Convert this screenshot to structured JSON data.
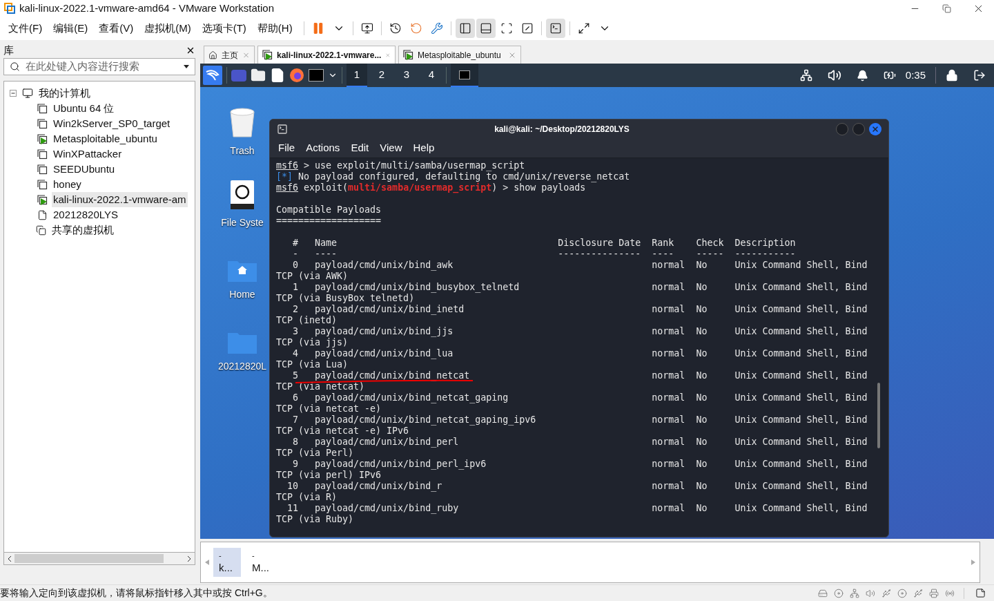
{
  "window": {
    "title": "kali-linux-2022.1-vmware-amd64 - VMware Workstation"
  },
  "menu": [
    "文件(F)",
    "编辑(E)",
    "查看(V)",
    "虚拟机(M)",
    "选项卡(T)",
    "帮助(H)"
  ],
  "library": {
    "title": "库",
    "search": {
      "placeholder": "在此处键入内容进行搜索"
    },
    "tree": [
      {
        "label": "我的计算机",
        "kind": "computer",
        "expanded": true,
        "children": [
          {
            "label": "Ubuntu 64 位",
            "kind": "vm",
            "running": false,
            "selected": false
          },
          {
            "label": "Win2kServer_SP0_target",
            "kind": "vm",
            "running": false,
            "selected": false
          },
          {
            "label": "Metasploitable_ubuntu",
            "kind": "vm",
            "running": true,
            "selected": false
          },
          {
            "label": "WinXPattacker",
            "kind": "vm",
            "running": false,
            "selected": false
          },
          {
            "label": "SEEDUbuntu",
            "kind": "vm",
            "running": false,
            "selected": false
          },
          {
            "label": "honey",
            "kind": "vm",
            "running": false,
            "selected": false
          },
          {
            "label": "kali-linux-2022.1-vmware-am",
            "kind": "vm",
            "running": true,
            "selected": true
          },
          {
            "label": "20212820LYS",
            "kind": "folder",
            "selected": false
          }
        ]
      },
      {
        "label": "共享的虚拟机",
        "kind": "shared"
      }
    ]
  },
  "tabs": [
    {
      "label": "主页",
      "kind": "home",
      "selected": false
    },
    {
      "label": "kali-linux-2022.1-vmware...",
      "kind": "vm",
      "selected": true
    },
    {
      "label": "Metasploitable_ubuntu",
      "kind": "vm",
      "selected": false
    }
  ],
  "guest": {
    "panel": {
      "workspaces": [
        {
          "label": "1",
          "selected": true
        },
        {
          "label": "2",
          "selected": false
        },
        {
          "label": "3",
          "selected": false
        },
        {
          "label": "4",
          "selected": false
        }
      ],
      "clock": "0:35"
    },
    "desktop_icons": [
      {
        "label": "Trash",
        "kind": "trash"
      },
      {
        "label": "File Syste",
        "kind": "drive"
      },
      {
        "label": "Home",
        "kind": "home"
      },
      {
        "label": "20212820L",
        "kind": "folder"
      }
    ],
    "terminal": {
      "title": "kali@kali: ~/Desktop/20212820LYS",
      "menu": [
        "File",
        "Actions",
        "Edit",
        "View",
        "Help"
      ],
      "lines": [
        {
          "kind": "prompt",
          "prompt": "msf6",
          "text": "> use exploit/multi/samba/usermap_script"
        },
        {
          "kind": "info",
          "tag": "[*]",
          "text": "No payload configured, defaulting to cmd/unix/reverse_netcat"
        },
        {
          "kind": "module_prompt",
          "prompt": "msf6",
          "before": "exploit(",
          "module": "multi/samba/usermap_script",
          "after": ") > show payloads"
        }
      ],
      "heading": "Compatible Payloads",
      "heading_rule": "===================",
      "columns": [
        {
          "label": "#",
          "rule": "-"
        },
        {
          "label": "Name",
          "rule": "----"
        },
        {
          "label": "Disclosure Date",
          "rule": "---------------"
        },
        {
          "label": "Rank",
          "rule": "----"
        },
        {
          "label": "Check",
          "rule": "-----"
        },
        {
          "label": "Description",
          "rule": "-----------"
        }
      ],
      "rows": [
        {
          "number": "0",
          "name": "payload/cmd/unix/bind_awk",
          "rank": "normal",
          "check": "No",
          "description": "Unix Command Shell, Bind",
          "description_cont": "TCP (via AWK)",
          "marked": false
        },
        {
          "number": "1",
          "name": "payload/cmd/unix/bind_busybox_telnetd",
          "rank": "normal",
          "check": "No",
          "description": "Unix Command Shell, Bind",
          "description_cont": "TCP (via BusyBox telnetd)",
          "marked": false
        },
        {
          "number": "2",
          "name": "payload/cmd/unix/bind_inetd",
          "rank": "normal",
          "check": "No",
          "description": "Unix Command Shell, Bind",
          "description_cont": "TCP (inetd)",
          "marked": false
        },
        {
          "number": "3",
          "name": "payload/cmd/unix/bind_jjs",
          "rank": "normal",
          "check": "No",
          "description": "Unix Command Shell, Bind",
          "description_cont": "TCP (via jjs)",
          "marked": false
        },
        {
          "number": "4",
          "name": "payload/cmd/unix/bind_lua",
          "rank": "normal",
          "check": "No",
          "description": "Unix Command Shell, Bind",
          "description_cont": "TCP (via Lua)",
          "marked": false
        },
        {
          "number": "5",
          "name": "payload/cmd/unix/bind_netcat",
          "rank": "normal",
          "check": "No",
          "description": "Unix Command Shell, Bind",
          "description_cont": "TCP (via netcat)",
          "marked": true
        },
        {
          "number": "6",
          "name": "payload/cmd/unix/bind_netcat_gaping",
          "rank": "normal",
          "check": "No",
          "description": "Unix Command Shell, Bind",
          "description_cont": "TCP (via netcat -e)",
          "marked": false
        },
        {
          "number": "7",
          "name": "payload/cmd/unix/bind_netcat_gaping_ipv6",
          "rank": "normal",
          "check": "No",
          "description": "Unix Command Shell, Bind",
          "description_cont": "TCP (via netcat -e) IPv6",
          "marked": false
        },
        {
          "number": "8",
          "name": "payload/cmd/unix/bind_perl",
          "rank": "normal",
          "check": "No",
          "description": "Unix Command Shell, Bind",
          "description_cont": "TCP (via Perl)",
          "marked": false
        },
        {
          "number": "9",
          "name": "payload/cmd/unix/bind_perl_ipv6",
          "rank": "normal",
          "check": "No",
          "description": "Unix Command Shell, Bind",
          "description_cont": "TCP (via perl) IPv6",
          "marked": false
        },
        {
          "number": "10",
          "name": "payload/cmd/unix/bind_r",
          "rank": "normal",
          "check": "No",
          "description": "Unix Command Shell, Bind",
          "description_cont": "TCP (via R)",
          "marked": false
        },
        {
          "number": "11",
          "name": "payload/cmd/unix/bind_ruby",
          "rank": "normal",
          "check": "No",
          "description": "Unix Command Shell, Bind",
          "description_cont": "TCP (via Ruby)",
          "marked": false
        }
      ]
    }
  },
  "thumbnails": [
    {
      "caption": "-",
      "label": "k...",
      "selected": true
    },
    {
      "caption": "-",
      "label": "M...",
      "selected": false
    }
  ],
  "status_bar": {
    "message": "要将输入定向到该虚拟机，请将鼠标指针移入其中或按 Ctrl+G。"
  }
}
